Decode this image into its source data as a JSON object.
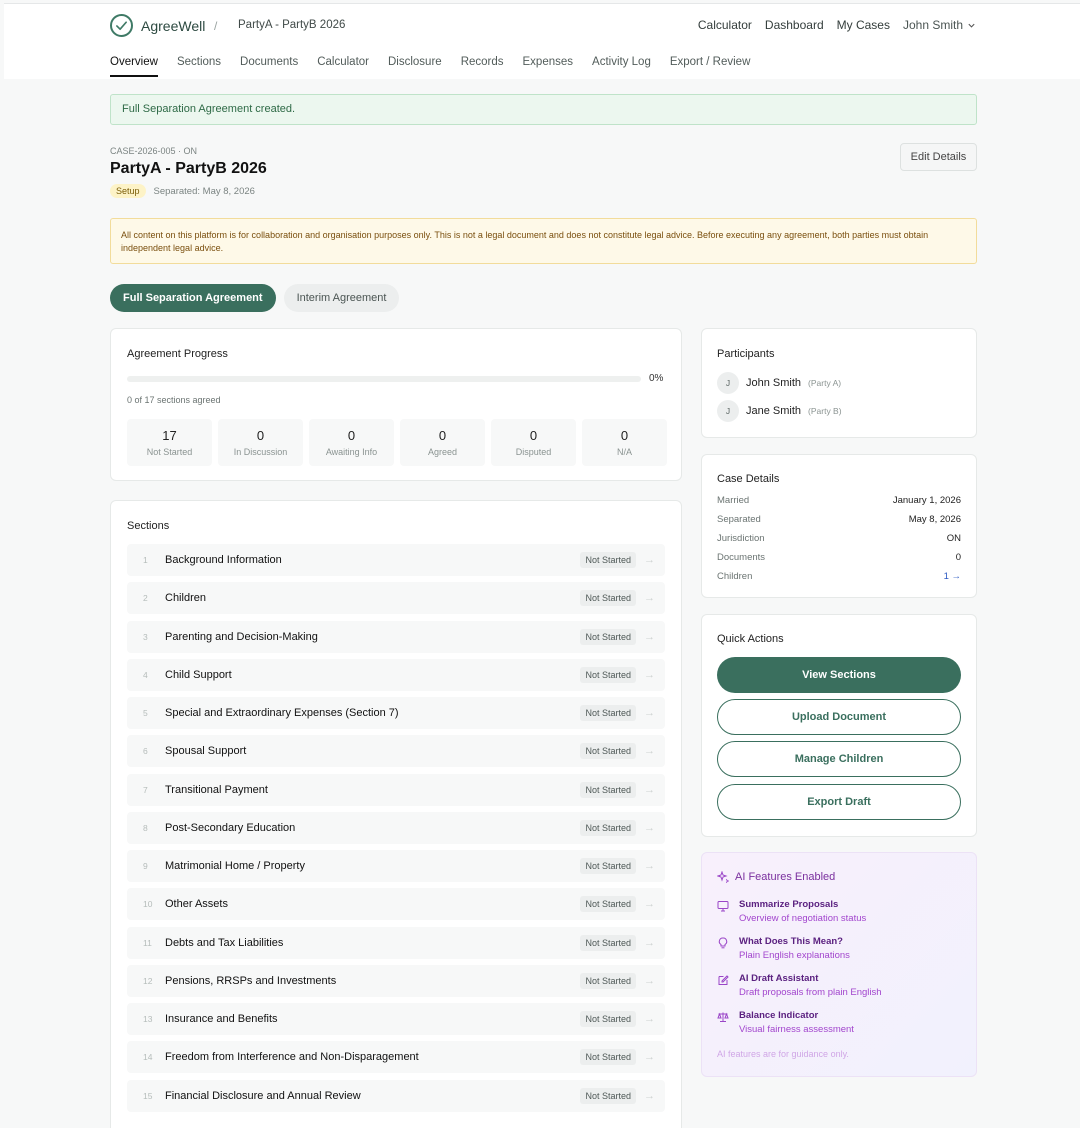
{
  "header": {
    "brand": "AgreeWell",
    "separator": "/",
    "breadcrumb": "PartyA - PartyB 2026",
    "nav": [
      "Calculator",
      "Dashboard",
      "My Cases"
    ],
    "user": "John Smith"
  },
  "tabs": [
    "Overview",
    "Sections",
    "Documents",
    "Calculator",
    "Disclosure",
    "Records",
    "Expenses",
    "Activity Log",
    "Export / Review"
  ],
  "banner": "Full Separation Agreement created.",
  "case": {
    "id": "CASE-2026-005 · ON",
    "title": "PartyA - PartyB 2026",
    "status": "Setup",
    "separated": "Separated: May 8, 2026",
    "edit_label": "Edit Details"
  },
  "disclaimer": "All content on this platform is for collaboration and organisation purposes only. This is not a legal document and does not constitute legal advice. Before executing any agreement, both parties must obtain independent legal advice.",
  "agreement_types": [
    "Full Separation Agreement",
    "Interim Agreement"
  ],
  "progress": {
    "title": "Agreement Progress",
    "percent_label": "0%",
    "percent": 0,
    "summary": "0 of 17 sections agreed",
    "stats": [
      {
        "value": "17",
        "label": "Not Started"
      },
      {
        "value": "0",
        "label": "In Discussion"
      },
      {
        "value": "0",
        "label": "Awaiting Info"
      },
      {
        "value": "0",
        "label": "Agreed"
      },
      {
        "value": "0",
        "label": "Disputed"
      },
      {
        "value": "0",
        "label": "N/A"
      }
    ]
  },
  "sections": {
    "title": "Sections",
    "items": [
      {
        "num": "1",
        "name": "Background Information",
        "status": "Not Started"
      },
      {
        "num": "2",
        "name": "Children",
        "status": "Not Started"
      },
      {
        "num": "3",
        "name": "Parenting and Decision-Making",
        "status": "Not Started"
      },
      {
        "num": "4",
        "name": "Child Support",
        "status": "Not Started"
      },
      {
        "num": "5",
        "name": "Special and Extraordinary Expenses (Section 7)",
        "status": "Not Started"
      },
      {
        "num": "6",
        "name": "Spousal Support",
        "status": "Not Started"
      },
      {
        "num": "7",
        "name": "Transitional Payment",
        "status": "Not Started"
      },
      {
        "num": "8",
        "name": "Post-Secondary Education",
        "status": "Not Started"
      },
      {
        "num": "9",
        "name": "Matrimonial Home / Property",
        "status": "Not Started"
      },
      {
        "num": "10",
        "name": "Other Assets",
        "status": "Not Started"
      },
      {
        "num": "11",
        "name": "Debts and Tax Liabilities",
        "status": "Not Started"
      },
      {
        "num": "12",
        "name": "Pensions, RRSPs and Investments",
        "status": "Not Started"
      },
      {
        "num": "13",
        "name": "Insurance and Benefits",
        "status": "Not Started"
      },
      {
        "num": "14",
        "name": "Freedom from Interference and Non-Disparagement",
        "status": "Not Started"
      },
      {
        "num": "15",
        "name": "Financial Disclosure and Annual Review",
        "status": "Not Started"
      }
    ]
  },
  "participants": {
    "title": "Participants",
    "items": [
      {
        "initial": "J",
        "name": "John Smith",
        "role": "(Party A)"
      },
      {
        "initial": "J",
        "name": "Jane Smith",
        "role": "(Party B)"
      }
    ]
  },
  "case_details": {
    "title": "Case Details",
    "rows": [
      {
        "label": "Married",
        "value": "January 1, 2026"
      },
      {
        "label": "Separated",
        "value": "May 8, 2026"
      },
      {
        "label": "Jurisdiction",
        "value": "ON"
      },
      {
        "label": "Documents",
        "value": "0"
      },
      {
        "label": "Children",
        "value": "1 →"
      }
    ]
  },
  "quick_actions": {
    "title": "Quick Actions",
    "buttons": [
      "View Sections",
      "Upload Document",
      "Manage Children",
      "Export Draft"
    ]
  },
  "ai": {
    "title": "AI Features Enabled",
    "items": [
      {
        "name": "Summarize Proposals",
        "desc": "Overview of negotiation status",
        "icon": "monitor-icon"
      },
      {
        "name": "What Does This Mean?",
        "desc": "Plain English explanations",
        "icon": "lightbulb-icon"
      },
      {
        "name": "AI Draft Assistant",
        "desc": "Draft proposals from plain English",
        "icon": "edit-icon"
      },
      {
        "name": "Balance Indicator",
        "desc": "Visual fairness assessment",
        "icon": "scale-icon"
      }
    ],
    "footnote": "AI features are for guidance only."
  },
  "colors": {
    "accent": "#3a6f5e",
    "ai_purple": "#7a2f9e",
    "success_bg": "#ecf7ef",
    "warning_bg": "#fef9e8"
  }
}
